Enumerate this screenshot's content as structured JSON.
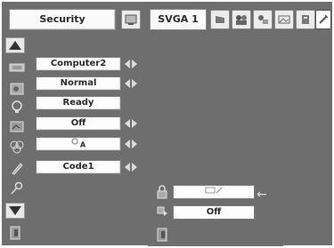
{
  "header": {
    "title": "Security",
    "source": "SVGA 1",
    "icons": [
      "image-adjust-icon",
      "input-source-icon",
      "screen-icon",
      "color-icon",
      "setting-icon",
      "sound-icon",
      "info-icon",
      "security-icon"
    ]
  },
  "sidebar": {
    "items": [
      "up-arrow-icon",
      "display-icon",
      "image-icon",
      "lamp-icon",
      "screen-icon",
      "color-icon",
      "pencil-icon",
      "key-icon",
      "down-arrow-icon",
      "exit-icon"
    ]
  },
  "rows": [
    {
      "value": "Computer2",
      "has_arrows": true
    },
    {
      "value": "Normal",
      "has_arrows": true
    },
    {
      "value": "Ready",
      "has_arrows": false
    },
    {
      "value": "Off",
      "has_arrows": true
    },
    {
      "value": "A",
      "has_arrows": true
    },
    {
      "value": "Code1",
      "has_arrows": true
    }
  ],
  "subpanel": {
    "row1_value": "",
    "row2_value": "Off"
  },
  "colors": {
    "background": "#6e6e6e",
    "box": "#fdfdfd",
    "arrow": "#dcdcdc"
  }
}
